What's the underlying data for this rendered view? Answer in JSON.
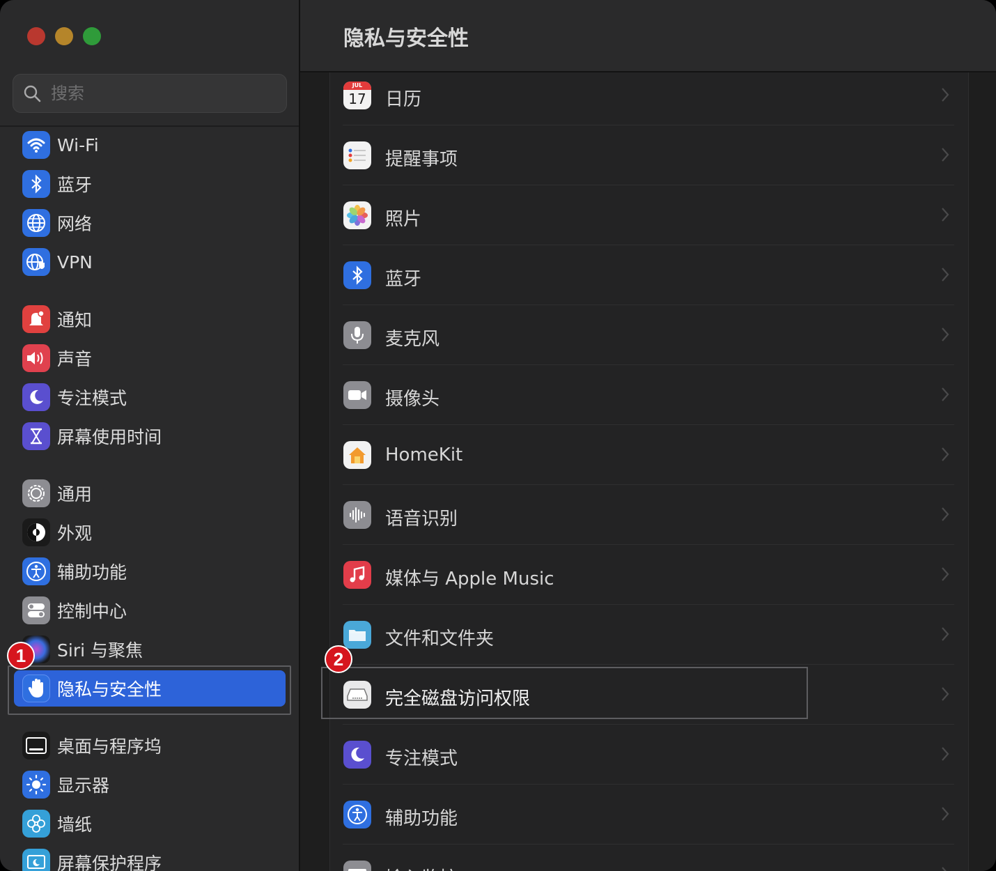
{
  "window": {
    "title": "隐私与安全性"
  },
  "search": {
    "placeholder": "搜索"
  },
  "sidebar": {
    "items": [
      {
        "label": "Wi-Fi",
        "icon": "wifi-icon",
        "color": "#2f6fe0"
      },
      {
        "label": "蓝牙",
        "icon": "bluetooth-icon",
        "color": "#2f6fe0"
      },
      {
        "label": "网络",
        "icon": "globe-icon",
        "color": "#2f6fe0"
      },
      {
        "label": "VPN",
        "icon": "vpn-globe-icon",
        "color": "#2f6fe0"
      },
      {
        "label": "通知",
        "icon": "bell-icon",
        "color": "#e0413f"
      },
      {
        "label": "声音",
        "icon": "speaker-icon",
        "color": "#e0414e"
      },
      {
        "label": "专注模式",
        "icon": "moon-icon",
        "color": "#5a4fcf"
      },
      {
        "label": "屏幕使用时间",
        "icon": "hourglass-icon",
        "color": "#5a4fcf"
      },
      {
        "label": "通用",
        "icon": "gear-icon",
        "color": "#8d8d92"
      },
      {
        "label": "外观",
        "icon": "appearance-icon",
        "color": "#1a1a1a"
      },
      {
        "label": "辅助功能",
        "icon": "accessibility-icon",
        "color": "#2f6fe0"
      },
      {
        "label": "控制中心",
        "icon": "toggles-icon",
        "color": "#8d8d92"
      },
      {
        "label": "Siri 与聚焦",
        "icon": "siri-icon",
        "color": "#222"
      },
      {
        "label": "隐私与安全性",
        "icon": "hand-icon",
        "color": "#2f6fe0"
      },
      {
        "label": "桌面与程序坞",
        "icon": "dock-icon",
        "color": "#1a1a1a"
      },
      {
        "label": "显示器",
        "icon": "sun-icon",
        "color": "#2f6fe0"
      },
      {
        "label": "墙纸",
        "icon": "flower-icon",
        "color": "#35a0d8"
      },
      {
        "label": "屏幕保护程序",
        "icon": "screensaver-icon",
        "color": "#35a0d8"
      }
    ]
  },
  "main": {
    "rows": [
      {
        "label": "日历",
        "icon": "calendar-icon",
        "calendar_month": "JUL",
        "calendar_day": "17"
      },
      {
        "label": "提醒事项",
        "icon": "reminders-icon"
      },
      {
        "label": "照片",
        "icon": "photos-icon"
      },
      {
        "label": "蓝牙",
        "icon": "bluetooth-icon"
      },
      {
        "label": "麦克风",
        "icon": "microphone-icon"
      },
      {
        "label": "摄像头",
        "icon": "camera-icon"
      },
      {
        "label": "HomeKit",
        "icon": "home-icon"
      },
      {
        "label": "语音识别",
        "icon": "waveform-icon"
      },
      {
        "label": "媒体与 Apple Music",
        "icon": "music-icon"
      },
      {
        "label": "文件和文件夹",
        "icon": "folder-icon"
      },
      {
        "label": "完全磁盘访问权限",
        "icon": "disk-icon"
      },
      {
        "label": "专注模式",
        "icon": "moon-icon"
      },
      {
        "label": "辅助功能",
        "icon": "accessibility-icon"
      },
      {
        "label": "输入监控",
        "icon": "keyboard-icon"
      }
    ]
  },
  "badges": {
    "one": "1",
    "two": "2"
  }
}
